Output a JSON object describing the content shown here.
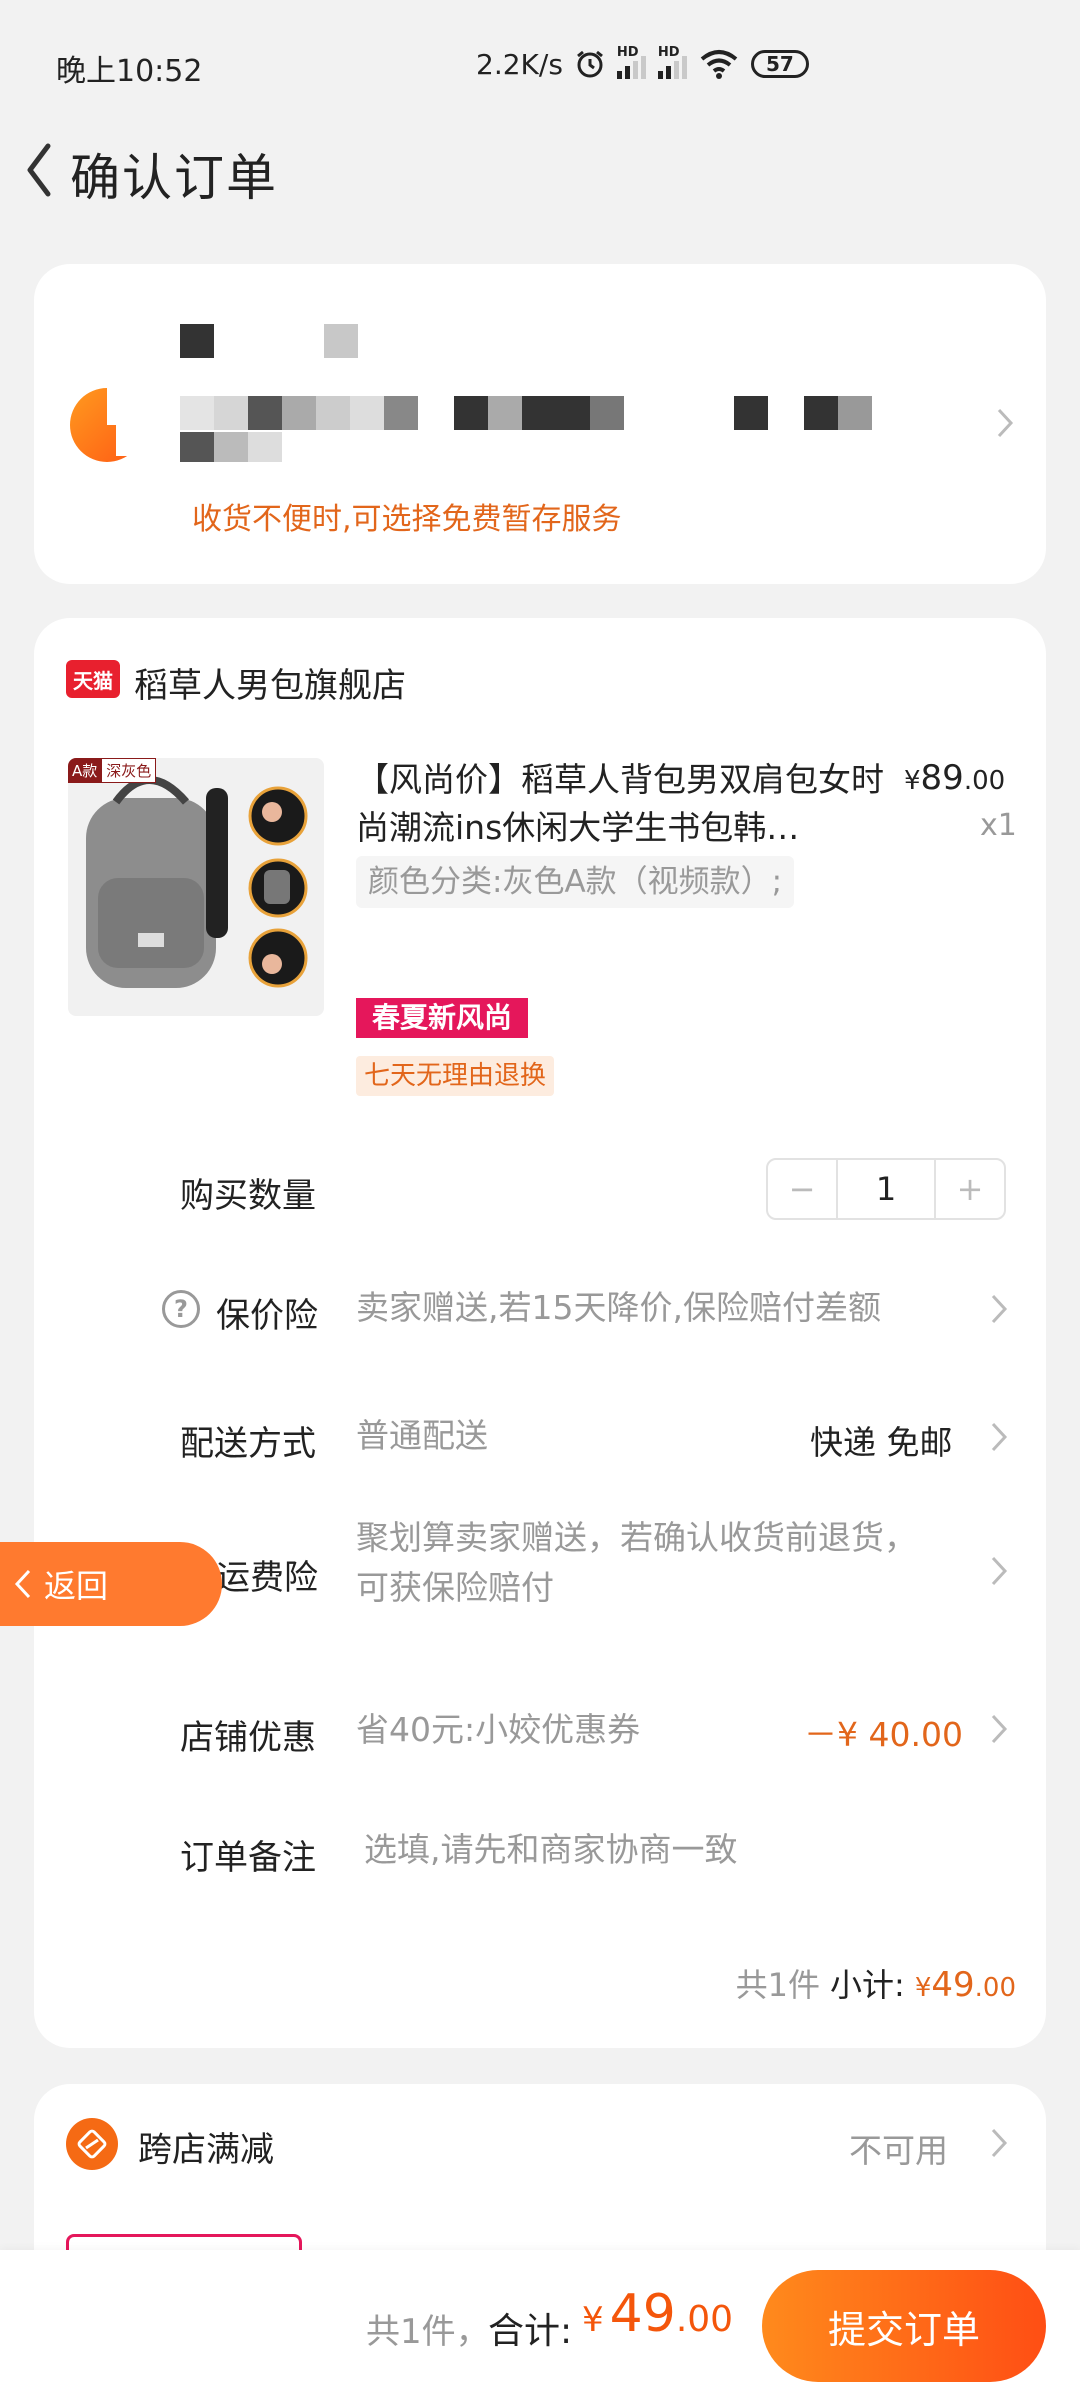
{
  "status_bar": {
    "time": "晚上10:52",
    "speed": "2.2K/s",
    "hd1": "HD",
    "hd2": "HD",
    "battery": "57"
  },
  "nav": {
    "title": "确认订单"
  },
  "address": {
    "free_storage_tip": "收货不便时,可选择免费暂存服务"
  },
  "store": {
    "badge": "天猫",
    "name": "稻草人男包旗舰店"
  },
  "product": {
    "image_tags": [
      "A款",
      "深灰色"
    ],
    "title": "【风尚价】稻草人背包男双肩包女时尚潮流ins休闲大学生书包韩…",
    "price_symbol": "¥",
    "price_int": "89",
    "price_dec": ".00",
    "quantity": "x1",
    "sku": "颜色分类:灰色A款（视频款）;",
    "promo_tag": "春夏新风尚",
    "return_tag": "七天无理由退换"
  },
  "rows": {
    "buy_qty": {
      "label": "购买数量",
      "value": "1",
      "minus": "−",
      "plus": "+"
    },
    "price_protect": {
      "label": "保价险",
      "value": "卖家赠送,若15天降价,保险赔付差额"
    },
    "delivery": {
      "label": "配送方式",
      "value": "普通配送",
      "right": "快递 免邮"
    },
    "shipping_ins": {
      "label": "运费险",
      "value_line1": "聚划算卖家赠送，若确认收货前退货，",
      "value_line2": "可获保险赔付"
    },
    "store_coupon": {
      "label": "店铺优惠",
      "value": "省40元:小姣优惠券",
      "right": "－¥ 40.00"
    },
    "note": {
      "label": "订单备注",
      "placeholder": "选填,请先和商家协商一致"
    }
  },
  "subtotal": {
    "count": "共1件",
    "label": "小计:",
    "symbol": "¥",
    "int": "49",
    "dec": ".00"
  },
  "cross_store": {
    "label": "跨店满减",
    "status": "不可用"
  },
  "float_return": {
    "label": "返回"
  },
  "bottom_bar": {
    "count": "共1件，",
    "total_label": "合计:",
    "symbol": "¥",
    "int": "49",
    "dec": ".00",
    "submit": "提交订单"
  },
  "colors": {
    "accent": "#f4560b",
    "tmall_red": "#e8202e",
    "promo_pink": "#e5175b",
    "background": "#f2f2f2"
  }
}
